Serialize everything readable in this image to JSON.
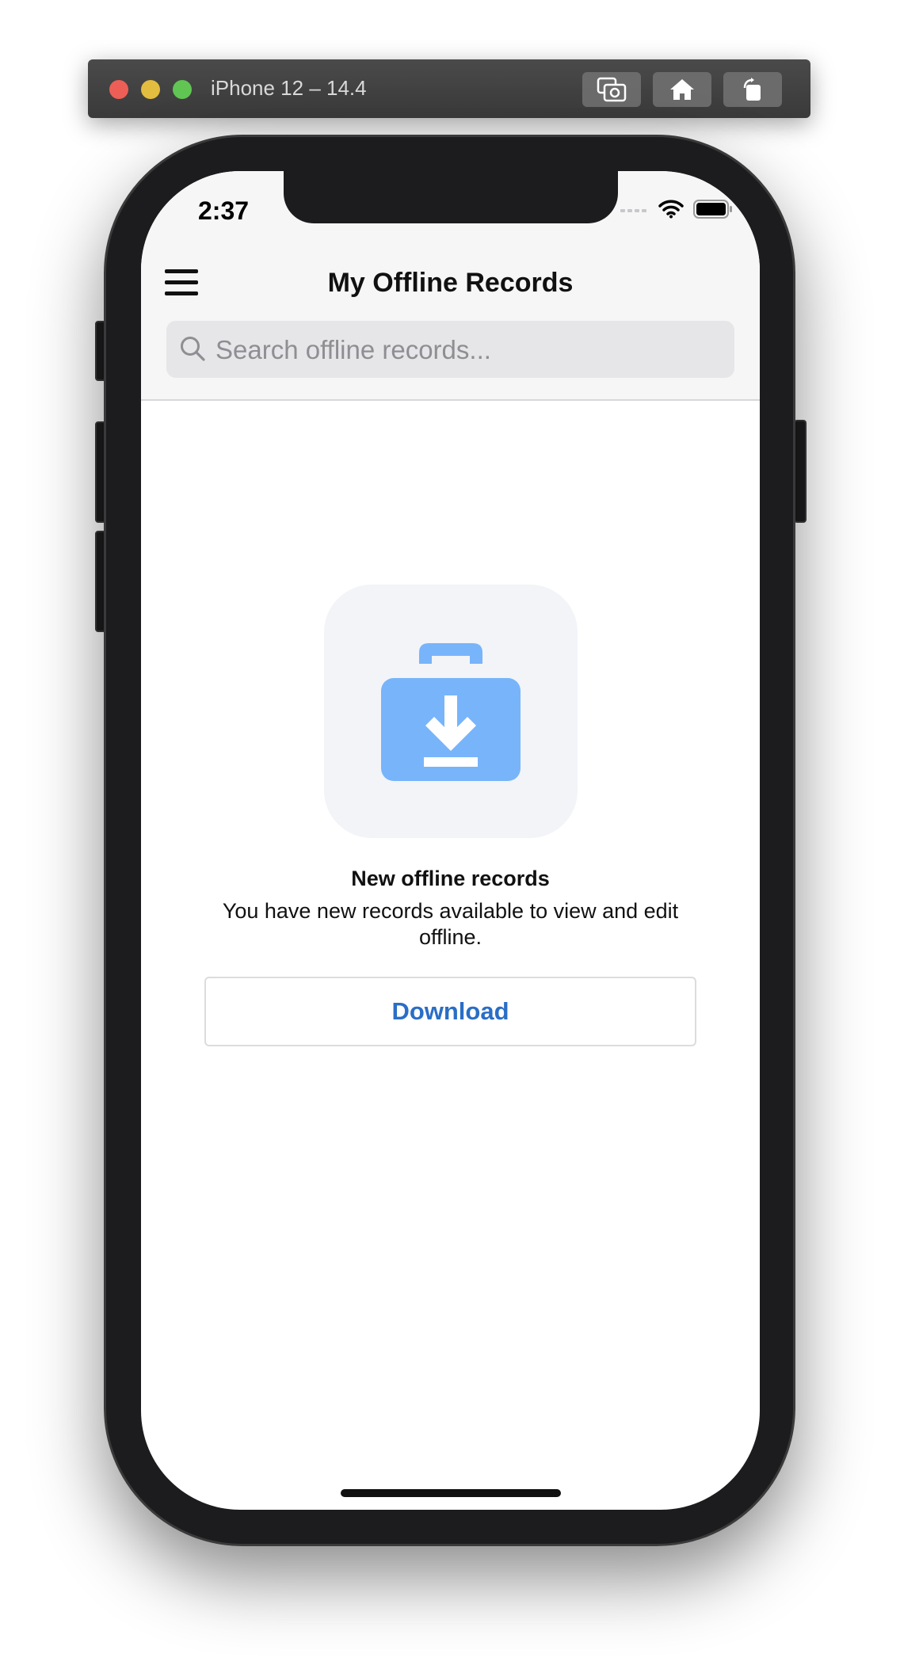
{
  "simulator": {
    "title": "iPhone 12 – 14.4",
    "buttons": {
      "screenshot_icon": "camera-icon",
      "home_icon": "home-icon",
      "rotate_icon": "rotate-icon"
    }
  },
  "status_bar": {
    "time": "2:37"
  },
  "nav": {
    "title": "My Offline Records",
    "menu_icon": "hamburger-menu-icon"
  },
  "search": {
    "placeholder": "Search offline records...",
    "value": ""
  },
  "empty_state": {
    "icon": "briefcase-download-icon",
    "title": "New offline records",
    "message": "You have new records available to view and edit offline.",
    "action_label": "Download"
  },
  "colors": {
    "accent": "#2a6ec6",
    "icon_blue": "#78b4fa",
    "tile_bg": "#f2f4f8",
    "header_bg": "#f6f6f7"
  }
}
